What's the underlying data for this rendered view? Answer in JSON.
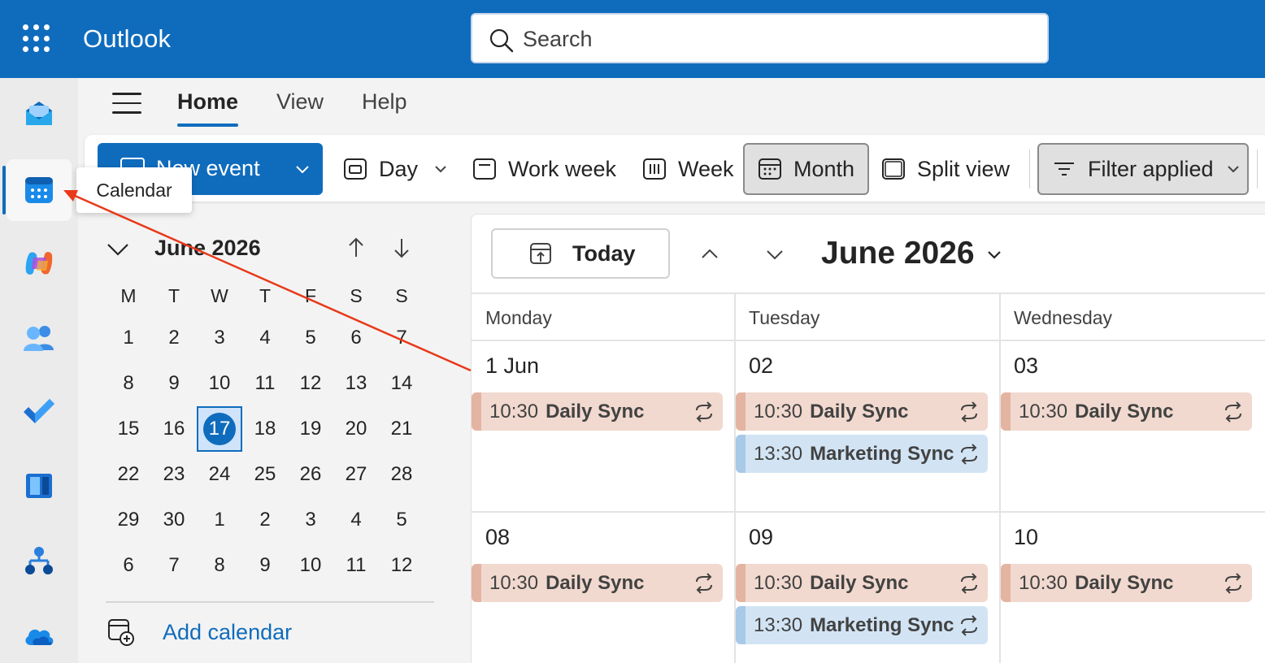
{
  "app": {
    "brand": "Outlook"
  },
  "search": {
    "placeholder": "Search"
  },
  "tabs": [
    {
      "label": "Home",
      "active": true
    },
    {
      "label": "View",
      "active": false
    },
    {
      "label": "Help",
      "active": false
    }
  ],
  "ribbon": {
    "new_event": "New event",
    "day": "Day",
    "work_week": "Work week",
    "week": "Week",
    "month": "Month",
    "split_view": "Split view",
    "filter": "Filter applied"
  },
  "tooltip": "Calendar",
  "mini_calendar": {
    "title": "June 2026",
    "weekdays": [
      "M",
      "T",
      "W",
      "T",
      "F",
      "S",
      "S"
    ],
    "weeks": [
      [
        "1",
        "2",
        "3",
        "4",
        "5",
        "6",
        "7"
      ],
      [
        "8",
        "9",
        "10",
        "11",
        "12",
        "13",
        "14"
      ],
      [
        "15",
        "16",
        "17",
        "18",
        "19",
        "20",
        "21"
      ],
      [
        "22",
        "23",
        "24",
        "25",
        "26",
        "27",
        "28"
      ],
      [
        "29",
        "30",
        "1",
        "2",
        "3",
        "4",
        "5"
      ],
      [
        "6",
        "7",
        "8",
        "9",
        "10",
        "11",
        "12"
      ]
    ],
    "today": "17",
    "add_calendar": "Add calendar"
  },
  "main": {
    "today_button": "Today",
    "month_title": "June 2026",
    "day_names": [
      "Monday",
      "Tuesday",
      "Wednesday"
    ],
    "row1_dates": [
      "1 Jun",
      "02",
      "03"
    ],
    "row2_dates": [
      "08",
      "09",
      "10"
    ],
    "events": {
      "daily_time": "10:30",
      "daily_title": "Daily Sync",
      "marketing_time": "13:30",
      "marketing_title": "Marketing Sync"
    }
  },
  "colors": {
    "brand_blue": "#0f6cbd",
    "event_orange": "#f1d9cf",
    "event_blue": "#d2e4f4",
    "annotation_arrow": "#e8391a"
  }
}
